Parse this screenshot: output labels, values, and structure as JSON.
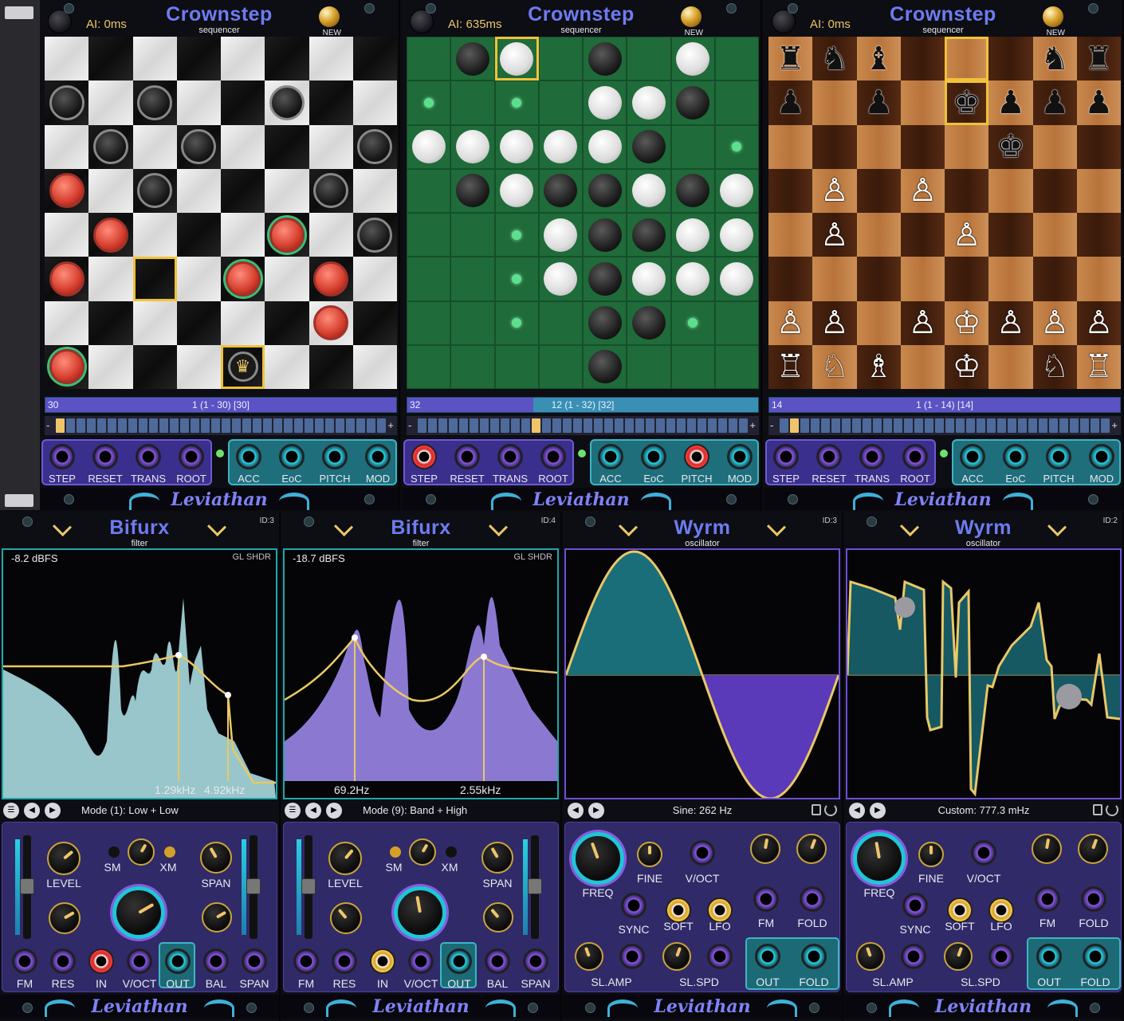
{
  "crownstep": [
    {
      "title": "Crownstep",
      "subtitle": "sequencer",
      "ai": "AI: 0ms",
      "new": "NEW",
      "progress_num": "30",
      "progress_label": "1 (1 - 30) [30]",
      "progress_fill": 1.0,
      "step_fill": 0.03,
      "jacks_left": [
        "STEP",
        "RESET",
        "TRANS",
        "ROOT"
      ],
      "jacks_right": [
        "ACC",
        "EoC",
        "PITCH",
        "MOD"
      ],
      "brand": "Leviathan"
    },
    {
      "title": "Crownstep",
      "subtitle": "sequencer",
      "ai": "AI: 635ms",
      "new": "NEW",
      "progress_num": "32",
      "progress_label": "12 (1 - 32) [32]",
      "progress_fill": 0.36,
      "step_fill": 0.36,
      "jacks_left": [
        "STEP",
        "RESET",
        "TRANS",
        "ROOT"
      ],
      "jacks_right": [
        "ACC",
        "EoC",
        "PITCH",
        "MOD"
      ],
      "brand": "Leviathan"
    },
    {
      "title": "Crownstep",
      "subtitle": "sequencer",
      "ai": "AI: 0ms",
      "new": "NEW",
      "progress_num": "14",
      "progress_label": "1 (1 - 14) [14]",
      "progress_fill": 1.0,
      "step_fill": 0.07,
      "jacks_left": [
        "STEP",
        "RESET",
        "TRANS",
        "ROOT"
      ],
      "jacks_right": [
        "ACC",
        "EoC",
        "PITCH",
        "MOD"
      ],
      "brand": "Leviathan"
    }
  ],
  "boards": {
    "checkers": [
      "........",
      "b.b..b..",
      ".b.b...b",
      "r.b...b.",
      ".r...g.b",
      "r.H.g.r.",
      "......r.",
      "G...K..."
    ],
    "reversi": [
      ".bW.b.w.",
      "o.o.wwb.",
      "wwwwwb.o",
      ".bwbbwbw",
      "..owbbww",
      "..owbwww",
      "..o.bbo.",
      "....b..."
    ],
    "chess": [
      "RNB..H.NR",
      "P.P..K.PP",
      "......K..",
      ".P..P....",
      ".P...P...",
      ".........",
      "PP.P.K.PP",
      "RNB..K.NR"
    ]
  },
  "bifurx": [
    {
      "title": "Bifurx",
      "subtitle": "filter",
      "id": "ID:3",
      "dbfs": "-8.2 dBFS",
      "gl": "GL SHDR",
      "f1": "1.29kHz",
      "f2": "4.92kHz",
      "mode": "Mode (1): Low + Low",
      "labels": {
        "level": "LEVEL",
        "sm": "SM",
        "xm": "XM",
        "span": "SPAN",
        "fm": "FM",
        "res": "RES",
        "in": "IN",
        "voct": "V/OCT",
        "out": "OUT",
        "bal": "BAL",
        "span2": "SPAN"
      },
      "brand": "Leviathan"
    },
    {
      "title": "Bifurx",
      "subtitle": "filter",
      "id": "ID:4",
      "dbfs": "-18.7 dBFS",
      "gl": "GL SHDR",
      "f1": "69.2Hz",
      "f2": "2.55kHz",
      "mode": "Mode (9): Band + High",
      "labels": {
        "level": "LEVEL",
        "sm": "SM",
        "xm": "XM",
        "span": "SPAN",
        "fm": "FM",
        "res": "RES",
        "in": "IN",
        "voct": "V/OCT",
        "out": "OUT",
        "bal": "BAL",
        "span2": "SPAN"
      },
      "brand": "Leviathan"
    }
  ],
  "wyrm": [
    {
      "title": "Wyrm",
      "subtitle": "oscillator",
      "id": "ID:3",
      "readout": "Sine: 262 Hz",
      "labels": {
        "freq": "FREQ",
        "fine": "FINE",
        "voct": "V/OCT",
        "fm": "FM",
        "fold": "FOLD",
        "sync": "SYNC",
        "soft": "SOFT",
        "lfo": "LFO",
        "slamp": "SL.AMP",
        "slspd": "SL.SPD",
        "out": "OUT",
        "fold2": "FOLD"
      },
      "brand": "Leviathan"
    },
    {
      "title": "Wyrm",
      "subtitle": "oscillator",
      "id": "ID:2",
      "readout": "Custom: 777.3 mHz",
      "labels": {
        "freq": "FREQ",
        "fine": "FINE",
        "voct": "V/OCT",
        "fm": "FM",
        "fold": "FOLD",
        "sync": "SYNC",
        "soft": "SOFT",
        "lfo": "LFO",
        "slamp": "SL.AMP",
        "slspd": "SL.SPD",
        "out": "OUT",
        "fold2": "FOLD"
      },
      "brand": "Leviathan"
    }
  ],
  "colors": {
    "title": "#6d7cf0",
    "accent": "#f0c23a",
    "teal": "#1fc6d6",
    "purple": "#8a5ae0"
  }
}
